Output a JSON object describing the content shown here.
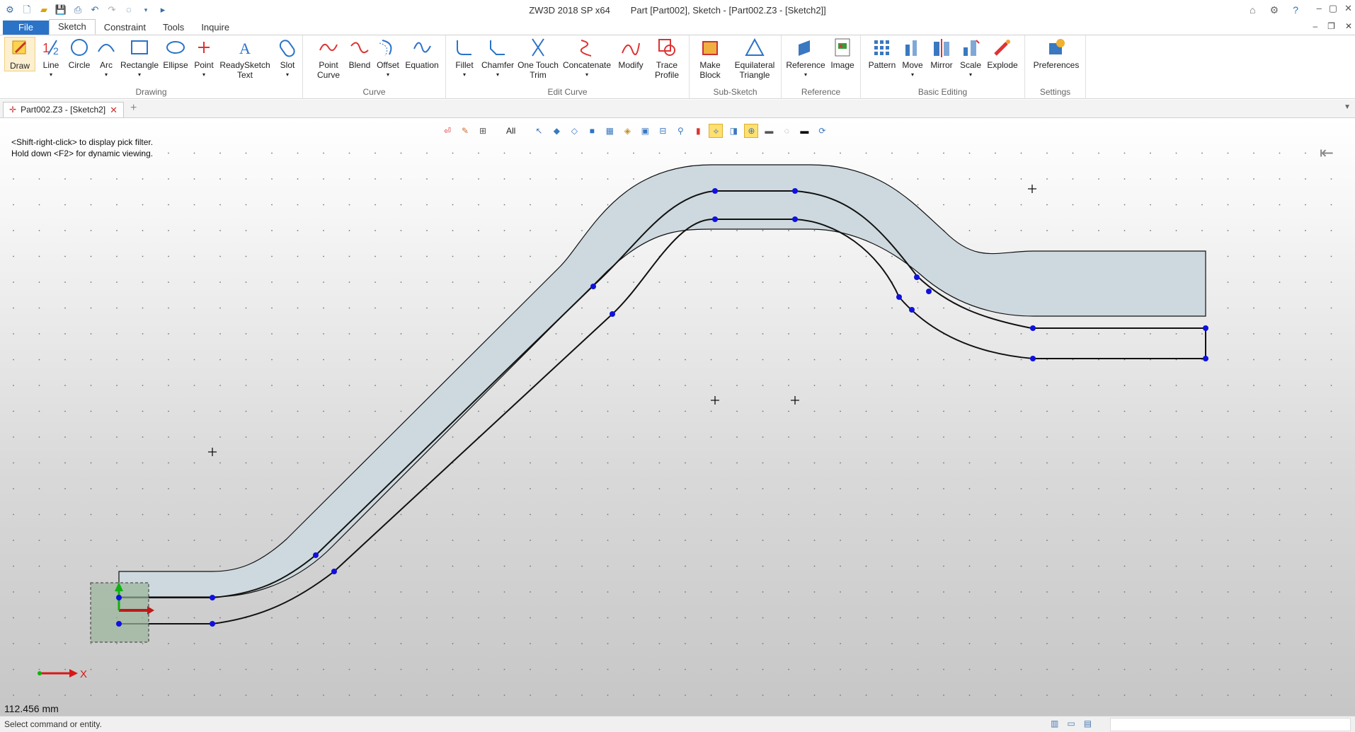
{
  "app": {
    "title": "ZW3D 2018 SP x64",
    "document": "Part [Part002],  Sketch - [Part002.Z3 - [Sketch2]]"
  },
  "ribbon_tabs": [
    "File",
    "Sketch",
    "Constraint",
    "Tools",
    "Inquire"
  ],
  "groups": {
    "drawing": {
      "label": "Drawing",
      "buttons": [
        "Draw",
        "Line",
        "Circle",
        "Arc",
        "Rectangle",
        "Ellipse",
        "Point",
        "ReadySketch Text",
        "Slot"
      ]
    },
    "curve": {
      "label": "Curve",
      "buttons": [
        "Point Curve",
        "Blend",
        "Offset",
        "Equation"
      ]
    },
    "edit_curve": {
      "label": "Edit Curve",
      "buttons": [
        "Fillet",
        "Chamfer",
        "One Touch Trim",
        "Concatenate",
        "Modify",
        "Trace Profile"
      ]
    },
    "sub_sketch": {
      "label": "Sub-Sketch",
      "buttons": [
        "Make Block",
        "Equilateral Triangle"
      ]
    },
    "reference": {
      "label": "Reference",
      "buttons": [
        "Reference",
        "Image"
      ]
    },
    "basic_editing": {
      "label": "Basic Editing",
      "buttons": [
        "Pattern",
        "Move",
        "Mirror",
        "Scale",
        "Explode"
      ]
    },
    "settings": {
      "label": "Settings",
      "buttons": [
        "Preferences"
      ]
    }
  },
  "doc_tab": "Part002.Z3 - [Sketch2]",
  "view_filter": "All",
  "hint": {
    "line1": "<Shift-right-click> to display pick filter.",
    "line2": "Hold down <F2> for dynamic viewing."
  },
  "measurement": "112.456 mm",
  "axis_label": "X",
  "status": "Select command or entity.",
  "colors": {
    "accent": "#2b73c7",
    "profile_fill": "#cdd9de",
    "point": "#1010e0",
    "axis_x": "#d81818",
    "axis_y": "#10b010"
  }
}
